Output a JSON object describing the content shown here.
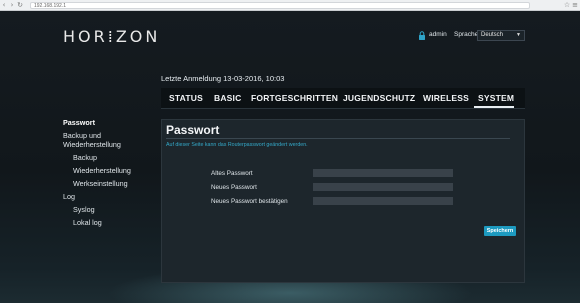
{
  "browser": {
    "url": "192.168.192.1",
    "back_icon": "back-arrow-icon",
    "forward_icon": "forward-arrow-icon",
    "reload_icon": "reload-icon"
  },
  "header": {
    "logo": "HOR⁞ZON",
    "user_icon": "lock-icon",
    "user": "admin",
    "language_label": "Sprache",
    "language_value": "Deutsch"
  },
  "last_login": "Letzte Anmeldung 13-03-2016, 10:03",
  "tabs": [
    {
      "label": "STATUS"
    },
    {
      "label": "BASIC"
    },
    {
      "label": "FORTGESCHRITTEN"
    },
    {
      "label": "JUGENDSCHUTZ"
    },
    {
      "label": "WIRELESS"
    },
    {
      "label": "SYSTEM",
      "active": true
    }
  ],
  "sidebar": {
    "items": [
      {
        "label": "Passwort",
        "active": true
      },
      {
        "label": "Backup und"
      },
      {
        "label": "Wiederherstellung"
      },
      {
        "label": "Backup"
      },
      {
        "label": "Wiederherstellung"
      },
      {
        "label": "Werkseinstellung"
      },
      {
        "label": "Log"
      },
      {
        "label": "Syslog"
      },
      {
        "label": "Lokal log"
      }
    ]
  },
  "panel": {
    "title": "Passwort",
    "description": "Auf dieser Seite kann das Routerpasswort geändert werden.",
    "fields": [
      {
        "label": "Altes Passwort",
        "value": ""
      },
      {
        "label": "Neues Passwort",
        "value": ""
      },
      {
        "label": "Neues Passwort bestätigen",
        "value": ""
      }
    ],
    "save_label": "Speichern"
  },
  "colors": {
    "accent": "#1d9ac0",
    "description_text": "#34a9c9",
    "background": "#11171b",
    "panel": "#1d262c"
  }
}
